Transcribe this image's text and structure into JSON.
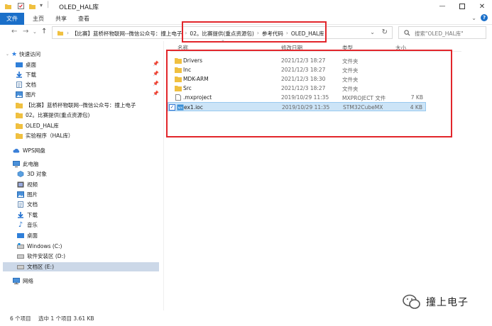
{
  "window": {
    "title": "OLED_HAL库",
    "controls": [
      "minimize-icon",
      "maximize-icon",
      "close-icon"
    ]
  },
  "ribbon": {
    "tabs": [
      "文件",
      "主页",
      "共享",
      "查看"
    ],
    "active_tab": "文件"
  },
  "address_bar": {
    "breadcrumbs": [
      "【比赛】蓝桥杯物联网--微信公众号：撞上电子",
      "02。比赛提供(重点资源包)",
      "参考代码",
      "OLED_HAL库"
    ],
    "search_placeholder": "搜索\"OLED_HAL库\""
  },
  "nav_pane": {
    "quick_access": "快速访问",
    "pinned": [
      "桌面",
      "下载",
      "文档",
      "图片"
    ],
    "recent": [
      "【比赛】蓝桥杯物联网--微信公众号：撞上电子",
      "02。比赛提供(重点资源包)",
      "OLED_HAL库",
      "实验程序（HAL库）"
    ],
    "wps": "WPS网盘",
    "this_pc": "此电脑",
    "pc_items": [
      "3D 对象",
      "视频",
      "图片",
      "文档",
      "下载",
      "音乐",
      "桌面"
    ],
    "drives": [
      "Windows (C:)",
      "软件安装区 (D:)",
      "文档区 (E:)"
    ],
    "selected_drive": "文档区 (E:)",
    "network": "网络"
  },
  "file_list": {
    "columns": [
      "名称",
      "修改日期",
      "类型",
      "大小"
    ],
    "rows": [
      {
        "name": "Drivers",
        "date": "2021/12/3 18:27",
        "type": "文件夹",
        "size": "",
        "icon": "folder-icon"
      },
      {
        "name": "Inc",
        "date": "2021/12/3 18:27",
        "type": "文件夹",
        "size": "",
        "icon": "folder-icon"
      },
      {
        "name": "MDK-ARM",
        "date": "2021/12/3 18:30",
        "type": "文件夹",
        "size": "",
        "icon": "folder-icon"
      },
      {
        "name": "Src",
        "date": "2021/12/3 18:27",
        "type": "文件夹",
        "size": "",
        "icon": "folder-icon"
      },
      {
        "name": ".mxproject",
        "date": "2019/10/29 11:35",
        "type": "MXPROJECT 文件",
        "size": "7 KB",
        "icon": "file-icon"
      },
      {
        "name": "ex1.ioc",
        "date": "2019/10/29 11:35",
        "type": "STM32CubeMX",
        "size": "4 KB",
        "icon": "cubemx-icon",
        "selected": true
      }
    ]
  },
  "status_bar": {
    "count": "6 个项目",
    "selection": "选中 1 个项目  3.61 KB"
  },
  "watermark": {
    "text": "撞上电子"
  },
  "colors": {
    "accent": "#1a6fc9",
    "highlight": "#e2262b",
    "folder": "#f0c040",
    "selection": "#cce4f7"
  }
}
